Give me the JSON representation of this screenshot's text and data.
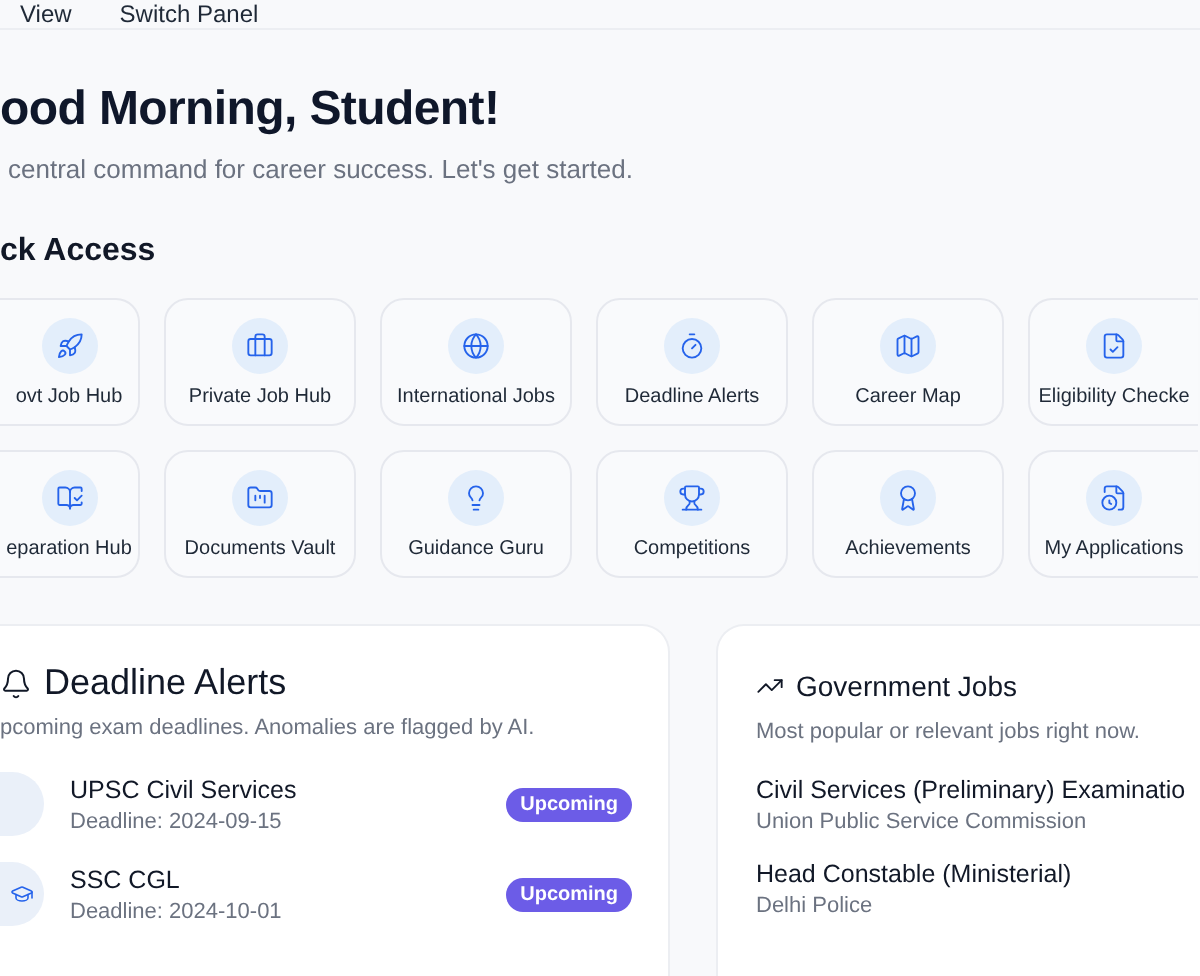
{
  "menu": [
    {
      "label": "View"
    },
    {
      "label": "Switch Panel"
    }
  ],
  "greeting": "ood Morning, Student!",
  "subtitle": "central command for career success. Let's get started.",
  "quick_access": {
    "title": "ck Access",
    "tiles": [
      {
        "label": "ovt Job Hub",
        "kind": "rocket"
      },
      {
        "label": "Private Job Hub",
        "kind": "briefcase"
      },
      {
        "label": "International Jobs",
        "kind": "globe"
      },
      {
        "label": "Deadline Alerts",
        "kind": "timer"
      },
      {
        "label": "Career Map",
        "kind": "map"
      },
      {
        "label": "Eligibility Checke",
        "kind": "file-check"
      },
      {
        "label": "eparation Hub",
        "kind": "book"
      },
      {
        "label": "Documents Vault",
        "kind": "folder"
      },
      {
        "label": "Guidance Guru",
        "kind": "lightbulb"
      },
      {
        "label": "Competitions",
        "kind": "trophy"
      },
      {
        "label": "Achievements",
        "kind": "award"
      },
      {
        "label": "My Applications",
        "kind": "file-clock"
      }
    ]
  },
  "deadline_alerts": {
    "title": "Deadline Alerts",
    "subtitle": "pcoming exam deadlines. Anomalies are flagged by AI.",
    "items": [
      {
        "name": "UPSC Civil Services",
        "deadline": "Deadline: 2024-09-15",
        "status": "Upcoming",
        "icon_visible": false
      },
      {
        "name": "SSC CGL",
        "deadline": "Deadline: 2024-10-01",
        "status": "Upcoming",
        "icon_visible": true
      }
    ]
  },
  "government_jobs": {
    "title": "Government Jobs",
    "subtitle": "Most popular or relevant jobs right now.",
    "items": [
      {
        "title": "Civil Services (Preliminary) Examinatio",
        "org": "Union Public Service Commission"
      },
      {
        "title": "Head Constable (Ministerial)",
        "org": "Delhi Police"
      }
    ]
  }
}
